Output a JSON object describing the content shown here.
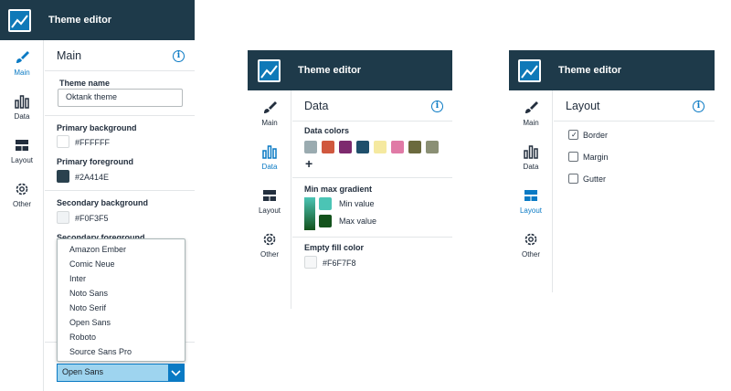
{
  "app": {
    "title": "Theme editor"
  },
  "nav": {
    "main": "Main",
    "data": "Data",
    "layout": "Layout",
    "other": "Other"
  },
  "panel1": {
    "section_title": "Main",
    "theme_name_label": "Theme name",
    "theme_name_value": "Oktank theme",
    "primary_bg_label": "Primary background",
    "primary_bg_value": "#FFFFFF",
    "primary_fg_label": "Primary foreground",
    "primary_fg_value": "#2A414E",
    "secondary_bg_label": "Secondary background",
    "secondary_bg_value": "#F0F3F5",
    "secondary_fg_label": "Secondary foreground",
    "font_options": [
      "Amazon Ember",
      "Comic Neue",
      "Inter",
      "Noto Sans",
      "Noto Serif",
      "Open Sans",
      "Roboto",
      "Source Sans Pro"
    ],
    "font_selected": "Open Sans"
  },
  "panel2": {
    "section_title": "Data",
    "data_colors_label": "Data colors",
    "data_colors": [
      "#9aabb0",
      "#d0583e",
      "#7d2a6e",
      "#1f4f6b",
      "#f5e9a0",
      "#e07aa6",
      "#6b6a3e",
      "#8a8f74"
    ],
    "add_symbol": "+",
    "gradient_label": "Min max gradient",
    "min_label": "Min value",
    "max_label": "Max value",
    "min_color": "#4bc4b5",
    "max_color": "#13521c",
    "empty_fill_label": "Empty fill color",
    "empty_fill_value": "#F6F7F8"
  },
  "panel3": {
    "section_title": "Layout",
    "options": [
      {
        "label": "Border",
        "checked": true
      },
      {
        "label": "Margin",
        "checked": false
      },
      {
        "label": "Gutter",
        "checked": false
      }
    ]
  },
  "info_symbol": "i",
  "check_symbol": "✓"
}
